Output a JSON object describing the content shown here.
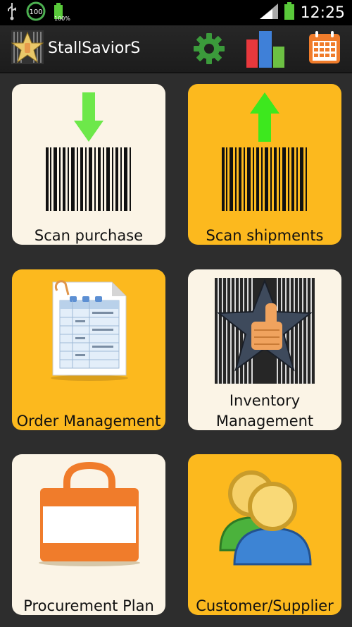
{
  "status_bar": {
    "time": "12:25",
    "battery_small_text": "100%",
    "sync_badge": "100"
  },
  "action_bar": {
    "title": "StallSaviorS",
    "icons": [
      "star-logo-icon",
      "gear-icon",
      "bar-chart-icon",
      "calendar-icon"
    ]
  },
  "tiles": [
    {
      "label": "Scan purchase",
      "icon": "barcode-down-arrow-icon",
      "bg": "#fbf4e6"
    },
    {
      "label": "Scan shipments",
      "icon": "barcode-up-arrow-icon",
      "bg": "#fcb91e"
    },
    {
      "label": "Order Management",
      "icon": "spreadsheet-document-icon",
      "bg": "#fcb91e"
    },
    {
      "label_line1": "Inventory",
      "label_line2": "Management",
      "icon": "barcode-star-thumb-icon",
      "bg": "#fbf4e6"
    },
    {
      "label": "Procurement Plan",
      "icon": "shopping-bag-icon",
      "bg": "#fbf4e6"
    },
    {
      "label": "Customer/Supplier",
      "icon": "people-icon",
      "bg": "#fcb91e"
    }
  ],
  "colors": {
    "accent_gold": "#fcb91e",
    "tile_cream": "#fbf4e6",
    "arrow_green": "#5ee83a"
  }
}
